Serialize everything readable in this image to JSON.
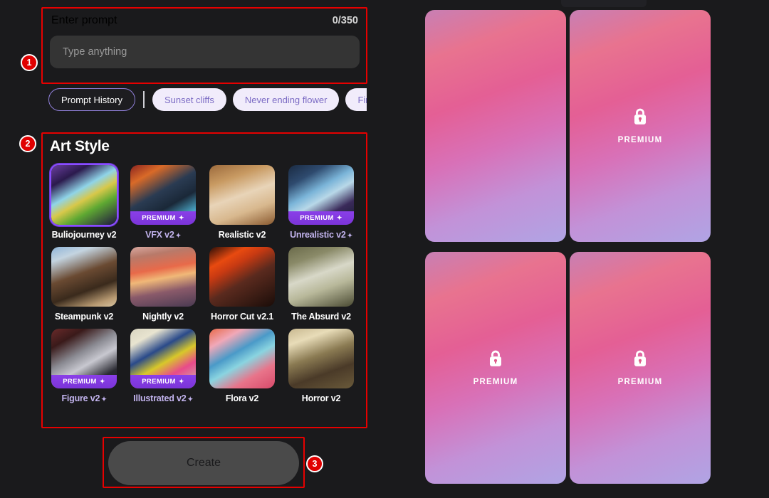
{
  "theme": {
    "page_bg": "#1a1a1c",
    "accent_purple": "#8a4dff",
    "annotation_red": "#e60000",
    "chip_lavender": "#f1ecfb",
    "chip_text_purple": "#7b6bc4"
  },
  "prompt": {
    "title": "Enter prompt",
    "counter": "0/350",
    "input_value": "",
    "placeholder": "Type anything"
  },
  "chips": {
    "history_label": "Prompt History",
    "suggestions": [
      {
        "label": "Sunset cliffs"
      },
      {
        "label": "Never ending flower"
      },
      {
        "label": "Fire and w"
      }
    ]
  },
  "art_style": {
    "title": "Art Style",
    "premium_badge_text": "PREMIUM",
    "sparkle": "✦",
    "tiles": [
      {
        "label": "Buliojourney v2",
        "premium": false,
        "selected": true,
        "sparkle": false,
        "art": "linear-gradient(150deg,#6b3fa0 0%,#2b1a4d 22%,#8fd4e8 42%,#d8c84a 55%,#5ea832 70%,#1e1440 100%)"
      },
      {
        "label": "VFX v2",
        "premium": true,
        "selected": false,
        "sparkle": true,
        "art": "linear-gradient(150deg,#8b2420 0%,#d96a28 20%,#2a3b52 45%,#1a2838 65%,#4aa8c8 85%,#18222e 100%)"
      },
      {
        "label": "Realistic v2",
        "premium": false,
        "selected": false,
        "sparkle": false,
        "art": "linear-gradient(160deg,#9c6a3c 0%,#c89a62 25%,#e8d4b8 50%,#d8b88e 72%,#8a5a30 100%)"
      },
      {
        "label": "Unrealistic v2",
        "premium": true,
        "selected": false,
        "sparkle": true,
        "art": "linear-gradient(150deg,#1a2a42 0%,#2e4a6e 22%,#7ab4d8 42%,#b8d8e8 55%,#3a2a5a 75%,#141c2c 100%)"
      },
      {
        "label": "Steampunk v2",
        "premium": false,
        "selected": false,
        "sparkle": false,
        "art": "linear-gradient(160deg,#8fb4d8 0%,#c4d4e0 18%,#6a4a32 45%,#3a2a1c 68%,#b89a72 88%,#d8c4a0 100%)"
      },
      {
        "label": "Nightly v2",
        "premium": false,
        "selected": false,
        "sparkle": false,
        "art": "linear-gradient(170deg,#d8a8a0 0%,#b87a6a 16%,#e86a4a 38%,#f0b878 52%,#8a5a6a 72%,#4a3a52 100%)"
      },
      {
        "label": "Horror Cut v2.1",
        "premium": false,
        "selected": false,
        "sparkle": false,
        "art": "linear-gradient(150deg,#2a0e08 0%,#e84a10 22%,#c83a12 34%,#5a2a1e 56%,#3a1c14 78%,#1a0c08 100%)"
      },
      {
        "label": "The Absurd v2",
        "premium": false,
        "selected": false,
        "sparkle": false,
        "art": "linear-gradient(160deg,#6a6a4a 0%,#8a8a68 22%,#d8d8c8 46%,#b8b89a 66%,#4a4a32 100%)"
      },
      {
        "label": "Figure v2",
        "premium": true,
        "selected": false,
        "sparkle": true,
        "art": "linear-gradient(150deg,#6a2a2a 0%,#3a1a1a 20%,#8a8a92 42%,#c8c8d0 58%,#2a2a32 80%,#1a1a20 100%)"
      },
      {
        "label": "Illustrated v2",
        "premium": true,
        "selected": false,
        "sparkle": true,
        "art": "linear-gradient(150deg,#d8d4c0 0%,#e8e4d0 18%,#2a4a8a 38%,#d8c82a 55%,#e84a8a 72%,#c8c4b0 100%)"
      },
      {
        "label": "Flora v2",
        "premium": false,
        "selected": false,
        "sparkle": false,
        "art": "linear-gradient(150deg,#e86a4a 0%,#f0a8b8 20%,#4a9ac8 40%,#8ad4e0 55%,#e8748a 75%,#d84a6a 100%)"
      },
      {
        "label": "Horror v2",
        "premium": false,
        "selected": false,
        "sparkle": false,
        "art": "linear-gradient(160deg,#c8b890 0%,#e8dcb8 20%,#8a7a52 45%,#4a3a28 70%,#6a5a3a 100%)"
      }
    ]
  },
  "create": {
    "label": "Create"
  },
  "results": {
    "premium_text": "PREMIUM",
    "cards": [
      {
        "locked": false
      },
      {
        "locked": true
      },
      {
        "locked": true
      },
      {
        "locked": true
      }
    ]
  },
  "annotations": {
    "markers": [
      {
        "number": "1"
      },
      {
        "number": "2"
      },
      {
        "number": "3"
      }
    ]
  }
}
